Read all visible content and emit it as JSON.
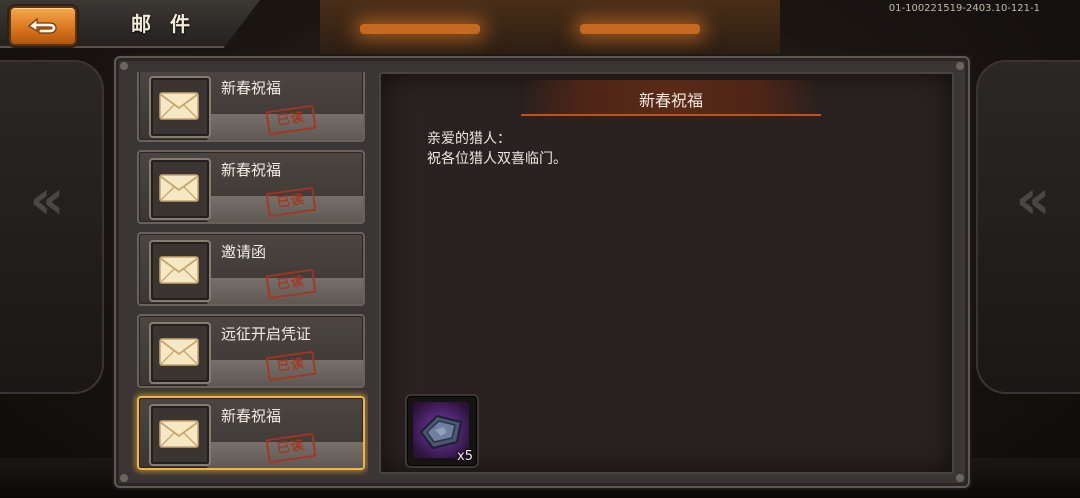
{
  "header": {
    "title": "邮 件",
    "version": "01-100221519-2403.10-121-1",
    "back_icon": "back-arrow-icon"
  },
  "mail_list": [
    {
      "title": "新春祝福",
      "status": "已读",
      "icon": "envelope-icon",
      "selected": false
    },
    {
      "title": "新春祝福",
      "status": "已读",
      "icon": "envelope-icon",
      "selected": false
    },
    {
      "title": "邀请函",
      "status": "已读",
      "icon": "envelope-icon",
      "selected": false
    },
    {
      "title": "远征开启凭证",
      "status": "已读",
      "icon": "envelope-icon",
      "selected": false
    },
    {
      "title": "新春祝福",
      "status": "已读",
      "icon": "envelope-icon",
      "selected": true
    }
  ],
  "detail": {
    "title": "新春祝福",
    "greeting": "亲爱的猎人：",
    "body": "祝各位猎人双喜临门。",
    "reward": {
      "icon": "armor-item-icon",
      "count": "x5"
    }
  },
  "colors": {
    "accent_orange": "#d8731c",
    "selected_border": "#f0b640",
    "stamp_red": "#a8341f"
  }
}
